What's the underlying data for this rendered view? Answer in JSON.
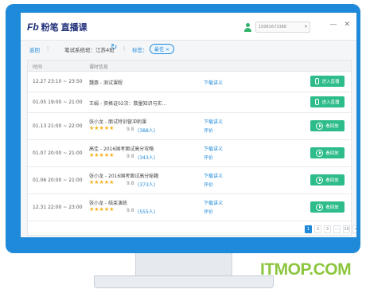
{
  "app": {
    "logo_mark": "Fb",
    "logo_text_1": "粉笔",
    "logo_text_2": "直播课",
    "user_account": "15081673388",
    "window_buttons": [
      "—",
      "✕"
    ]
  },
  "filter": {
    "back_label": "返回",
    "separator": "|",
    "course": "笔试系统班：江苏4班",
    "tag_label": "标签：",
    "tag_value": "最佳"
  },
  "table": {
    "headers": {
      "time": "时间",
      "info": "课时信息"
    },
    "rows": [
      {
        "time": "12.27 23:10 ~ 23:50",
        "title": "魏惠 - 测试课程",
        "link": "下载讲义",
        "link2": "",
        "rating": "",
        "score": "",
        "count": "",
        "button": "进入直播",
        "button_type": "live"
      },
      {
        "time": "01.05 19:00 ~ 21:00",
        "title": "王娟 - 资格证02次：数量知识与实…",
        "link": "",
        "link2": "",
        "rating": "",
        "score": "",
        "count": "",
        "button": "进入直播",
        "button_type": "live"
      },
      {
        "time": "01.13 21:00 ~ 22:00",
        "title": "张小龙 - 面试特训营冲刺课",
        "link": "下载讲义",
        "link2": "评价",
        "rating": "★★★★★",
        "score": "9.8",
        "count": "(388人)",
        "button": "看回放",
        "button_type": "replay"
      },
      {
        "time": "01.07 20:00 ~ 21:00",
        "title": "高佳 - 2016国考面试高分攻略",
        "link": "下载讲义",
        "link2": "评价",
        "rating": "★★★★★",
        "score": "9.8",
        "count": "(343人)",
        "button": "看回放",
        "button_type": "replay"
      },
      {
        "time": "01.06 20:00 ~ 21:00",
        "title": "张小龙 - 2016国考面试高分秘籍",
        "link": "下载讲义",
        "link2": "评价",
        "rating": "★★★★★",
        "score": "9.8",
        "count": "(373人)",
        "button": "看回放",
        "button_type": "replay"
      },
      {
        "time": "12.31 22:00 ~ 23:00",
        "title": "张小龙 - 结束演练",
        "link": "下载讲义",
        "link2": "评价",
        "rating": "★★★★★",
        "score": "9.8",
        "count": "(555人)",
        "button": "看回放",
        "button_type": "replay"
      }
    ]
  },
  "pager": [
    "1",
    "2",
    "3",
    "...",
    "10",
    ">"
  ],
  "watermark": "ITMOP.COM",
  "colors": {
    "frame": "#1f8ad9",
    "accent": "#1f8ad9",
    "button": "#2dbc8a",
    "star": "#f5b21a",
    "watermark": "#8cc63f"
  }
}
